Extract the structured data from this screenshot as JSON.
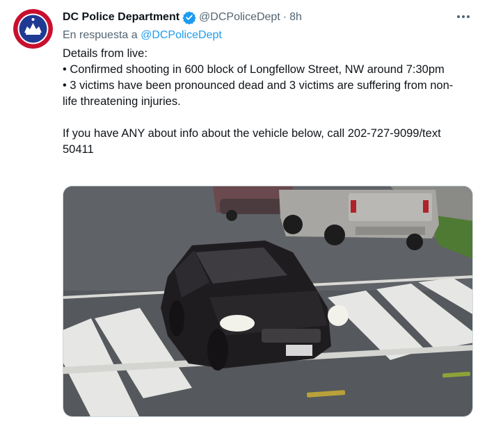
{
  "tweet": {
    "author_name": "DC Police Department",
    "handle": "@DCPoliceDept",
    "separator": "·",
    "time": "8h",
    "reply_prefix": "En respuesta a ",
    "reply_to": "@DCPoliceDept",
    "verified": true,
    "lines": [
      "Details from live:",
      "• Confirmed shooting in 600 block of Longfellow Street, NW around 7:30pm",
      "• 3 victims have been pronounced dead and 3 victims are suffering from non-life threatening injuries.",
      "",
      "If you have ANY about info about the vehicle below, call 202-727-9099/text 50411"
    ],
    "more_icon": "more-horizontal-icon",
    "avatar_icon": "police-badge-icon",
    "media_subject": "dark sedan on crosswalk"
  },
  "colors": {
    "link": "#1d9bf0",
    "secondary": "#536471",
    "avatar_red": "#c8102e",
    "avatar_blue": "#1f3a93"
  }
}
